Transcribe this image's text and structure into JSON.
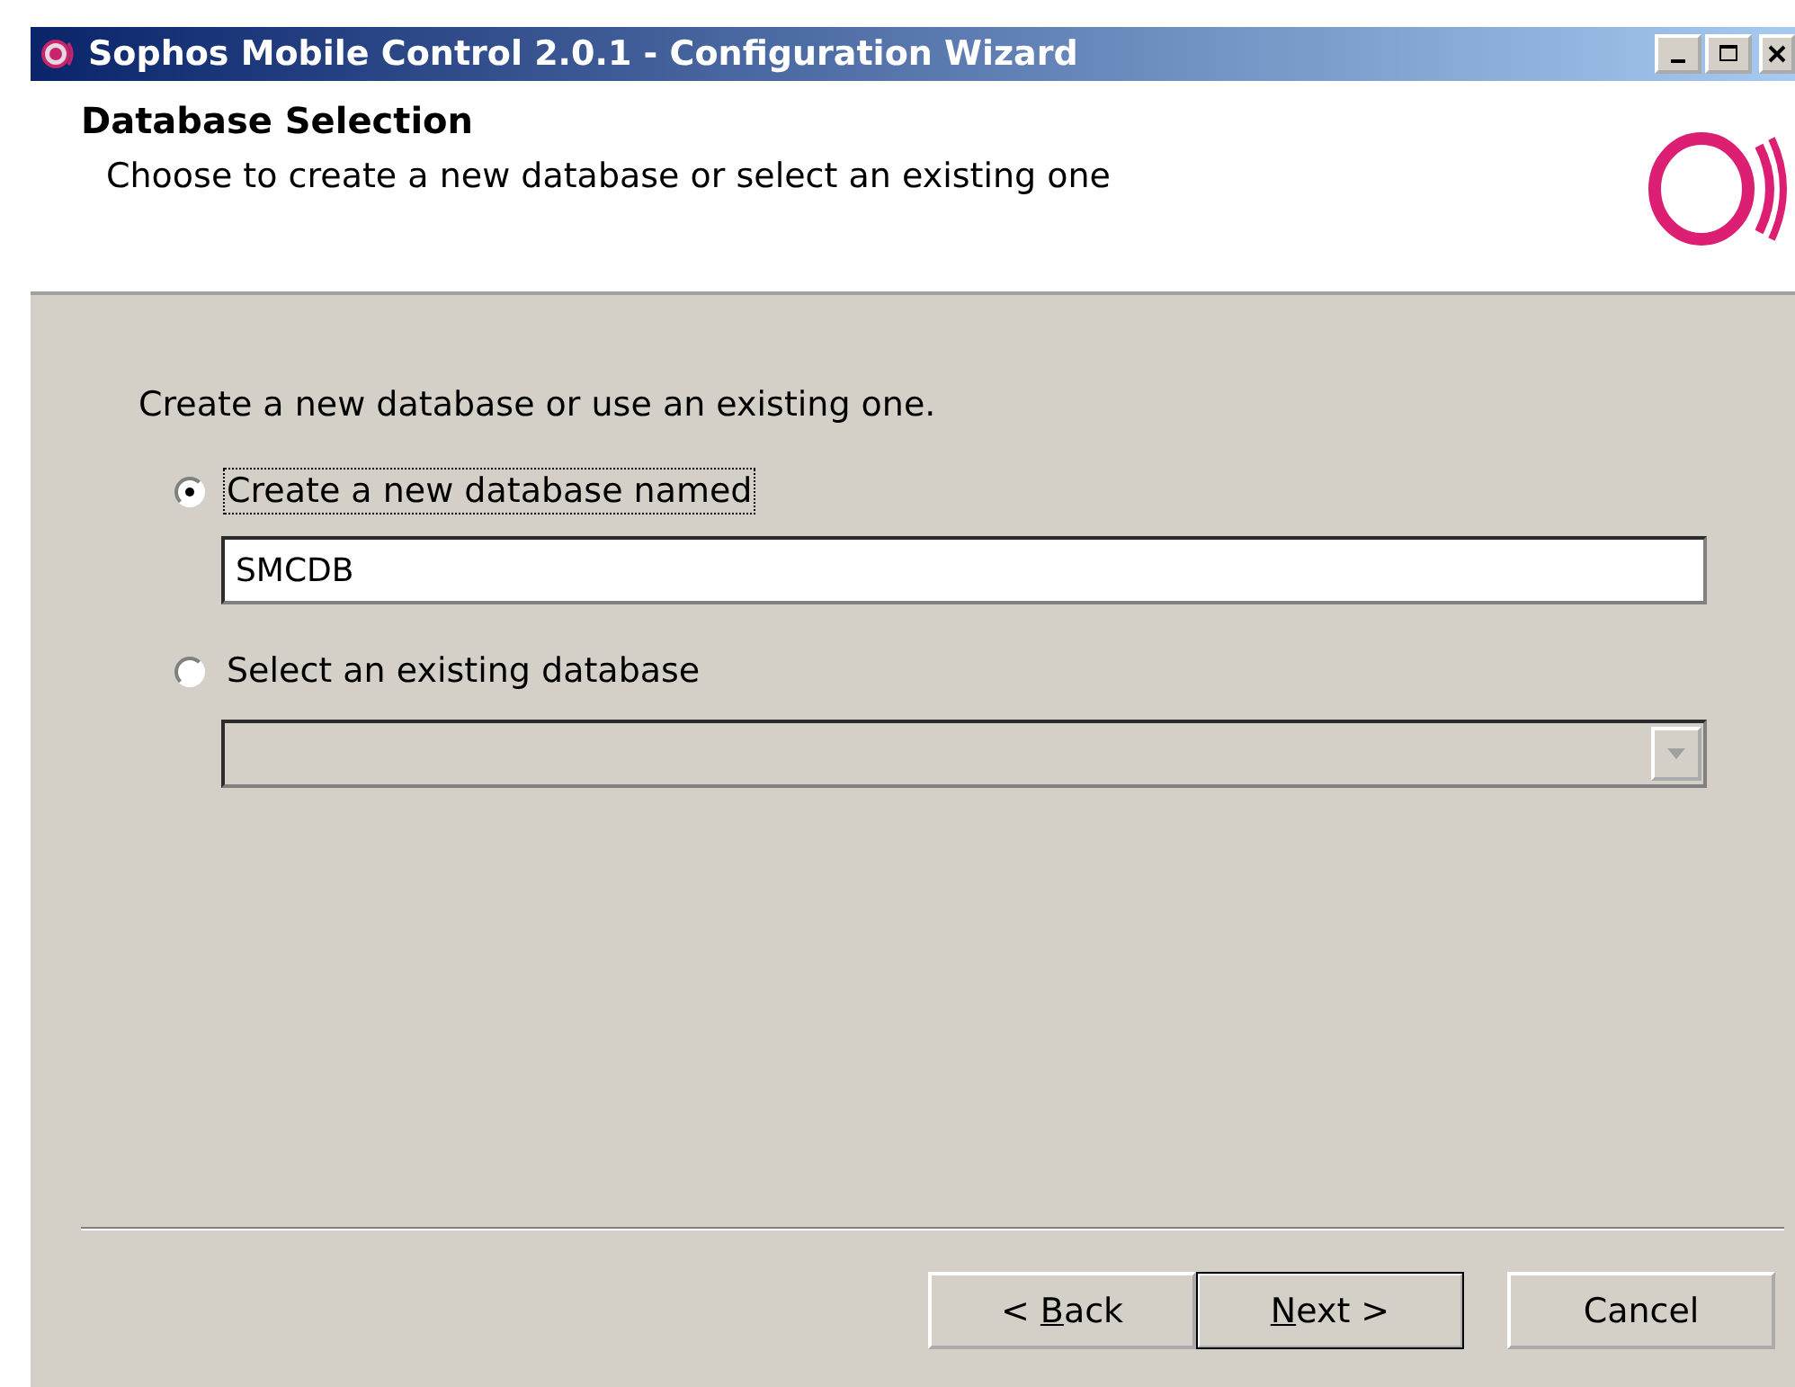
{
  "window": {
    "title": "Sophos Mobile Control 2.0.1 - Configuration Wizard"
  },
  "header": {
    "title": "Database Selection",
    "subtitle": "Choose to create a new database or select an existing one"
  },
  "prompt": "Create a new database or use an existing one.",
  "options": [
    {
      "label": "Create a new database named",
      "selected": true,
      "focused": true,
      "kind": "text",
      "value": "SMCDB",
      "disabled": false
    },
    {
      "label": "Select an existing database",
      "selected": false,
      "focused": false,
      "kind": "combo",
      "disabled": true
    }
  ],
  "buttons": [
    {
      "before": "< ",
      "key": "B",
      "after": "ack",
      "default": false
    },
    {
      "key": "N",
      "after": "ext >",
      "default": true
    },
    {
      "before": "Cancel",
      "default": false
    }
  ]
}
